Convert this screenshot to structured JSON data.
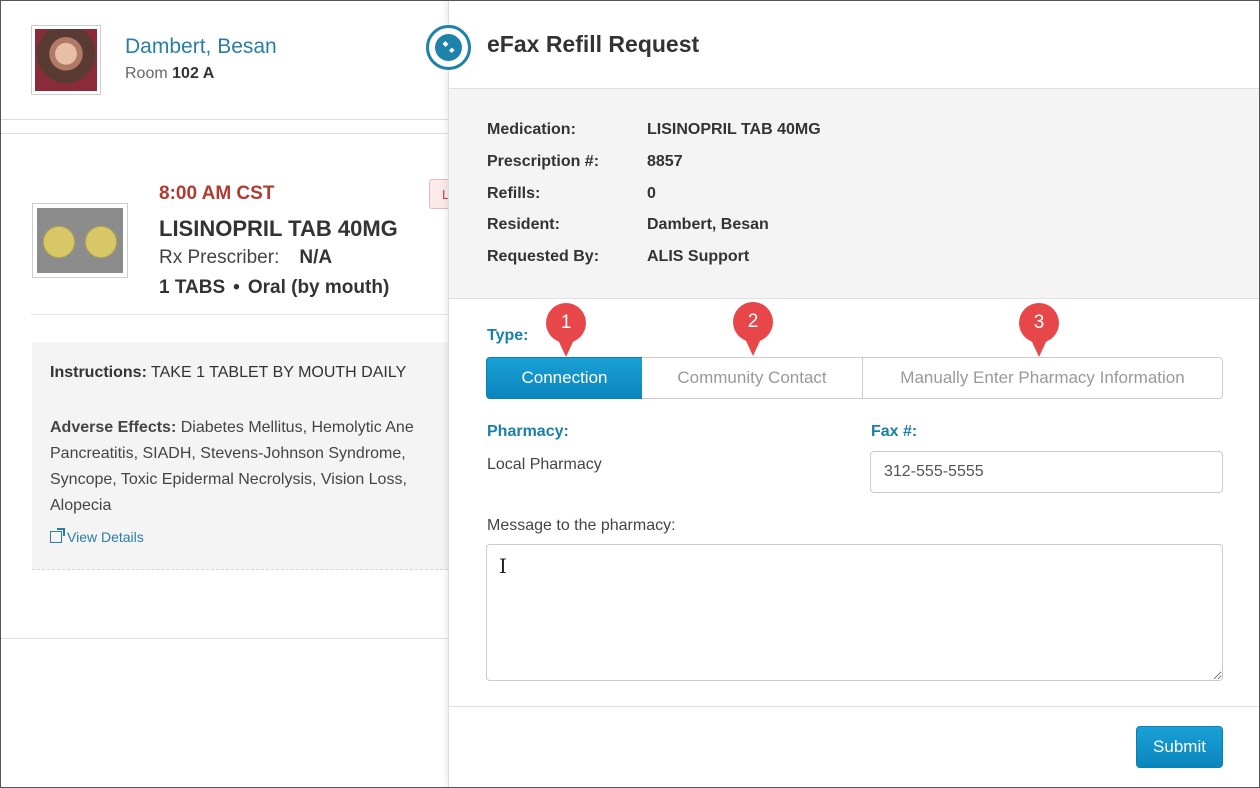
{
  "patient": {
    "name": "Dambert, Besan",
    "room_label": "Room",
    "room_number": "102 A"
  },
  "medication_card": {
    "time": "8:00 AM CST",
    "badge": "L",
    "name": "LISINOPRIL TAB 40MG",
    "prescriber_label": "Rx Prescriber:",
    "prescriber_value": "N/A",
    "dose": "1 TABS",
    "route": "Oral (by mouth)",
    "instructions_label": "Instructions:",
    "instructions_value": "TAKE 1 TABLET BY MOUTH DAILY",
    "adverse_label": "Adverse Effects:",
    "adverse_value": "Diabetes Mellitus, Hemolytic Ane Pancreatitis, SIADH, Stevens-Johnson Syndrome, Syncope, Toxic Epidermal Necrolysis, Vision Loss, Alopecia",
    "view_details": "View Details"
  },
  "modal": {
    "title": "eFax Refill Request",
    "summary": [
      {
        "label": "Medication:",
        "value": "LISINOPRIL TAB 40MG"
      },
      {
        "label": "Prescription #:",
        "value": "8857"
      },
      {
        "label": "Refills:",
        "value": "0"
      },
      {
        "label": "Resident:",
        "value": "Dambert, Besan"
      },
      {
        "label": "Requested By:",
        "value": "ALIS Support"
      }
    ],
    "type_label": "Type:",
    "type_options": [
      "Connection",
      "Community Contact",
      "Manually Enter Pharmacy Information"
    ],
    "type_selected": "Connection",
    "callouts": [
      "1",
      "2",
      "3"
    ],
    "pharmacy_label": "Pharmacy:",
    "pharmacy_value": "Local Pharmacy",
    "fax_label": "Fax #:",
    "fax_value": "312-555-5555",
    "message_label": "Message to the pharmacy:",
    "message_value": "",
    "submit_label": "Submit"
  },
  "colors": {
    "accent": "#1a7fa9",
    "primary_button": "#0a86bd",
    "callout": "#e8474a",
    "time": "#b23a2e"
  },
  "icons": {
    "close": "close-circle-icon",
    "view_details": "external-link-icon",
    "cursor": "text-cursor-icon"
  }
}
